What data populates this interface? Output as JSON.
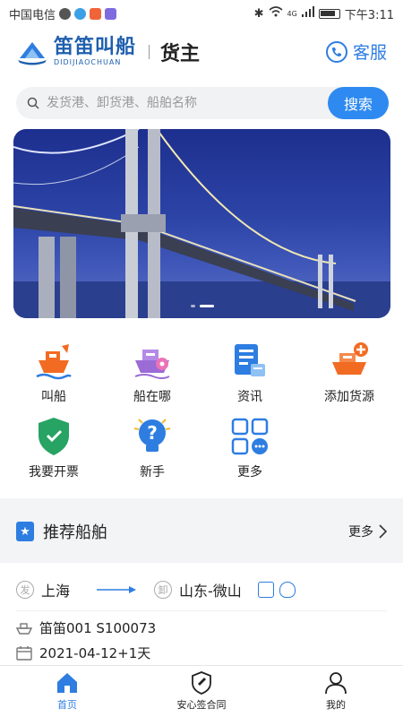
{
  "status_bar": {
    "carrier": "中国电信",
    "network": "4G",
    "time": "下午3:11"
  },
  "header": {
    "logo_cn": "笛笛叫船",
    "logo_en": "DIDIJIAOCHUAN",
    "role": "货主",
    "service_label": "客服"
  },
  "search": {
    "placeholder": "发货港、卸货港、船舶名称",
    "button_label": "搜索"
  },
  "banner": {
    "slide_count": 2,
    "active_slide": 2
  },
  "quick_actions": [
    {
      "label": "叫船",
      "icon": "ship-call-icon"
    },
    {
      "label": "船在哪",
      "icon": "ship-location-icon"
    },
    {
      "label": "资讯",
      "icon": "news-icon"
    },
    {
      "label": "添加货源",
      "icon": "add-cargo-icon"
    },
    {
      "label": "我要开票",
      "icon": "invoice-shield-icon"
    },
    {
      "label": "新手",
      "icon": "help-bulb-icon"
    },
    {
      "label": "更多",
      "icon": "more-grid-icon"
    }
  ],
  "recommended": {
    "title": "推荐船舶",
    "more_label": "更多",
    "card": {
      "from_tag": "发",
      "from_port": "上海",
      "to_tag": "卸",
      "to_port": "山东-微山",
      "ship": "笛笛001 S100073",
      "date": "2021-04-12+1天"
    }
  },
  "bottom_nav": [
    {
      "label": "首页",
      "icon": "home-icon",
      "active": true
    },
    {
      "label": "安心签合同",
      "icon": "contract-shield-icon",
      "active": false
    },
    {
      "label": "我的",
      "icon": "user-icon",
      "active": false
    }
  ],
  "colors": {
    "accent": "#2e7de1",
    "brand": "#1f5fae",
    "orange": "#f26b22",
    "purple": "#9b6bd6",
    "green": "#27a363"
  }
}
